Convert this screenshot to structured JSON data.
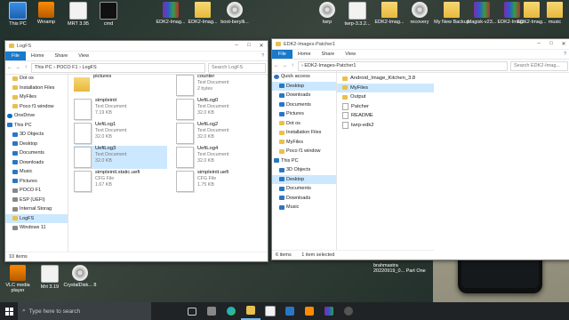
{
  "desktop_icons": {
    "this_pc": "This PC",
    "winamp": "Winamp",
    "mrt395": "MRT 3.95",
    "cmd": "cmd",
    "edk2_1": "EDK2-Imag...",
    "edk2_2": "EDK2-Imag...",
    "boot_beryllium": "boot-berylli...",
    "twrp": "twrp",
    "twrp_3_3": "twrp-3.3.2...",
    "edk2_3": "EDK2-Imag...",
    "recovery": "recovery",
    "my_new_backup": "My New Backup",
    "magisk": "Magisk-v23...",
    "edk2_4": "EDK2-Imag...",
    "edk2_5": "EDK2-Imag...",
    "music": "music",
    "vlc": "VLC media player",
    "mrt319": "Mrt 3.19",
    "crystaldisk": "CrystalDisk... 8",
    "brahmastra": "brahmastra 20220919_0... Part One"
  },
  "left_window": {
    "title": "LogFS",
    "ribbon": {
      "file": "File",
      "home": "Home",
      "share": "Share",
      "view": "View"
    },
    "path": "This PC  ›  POCO F1  ›  LogFS",
    "search_placeholder": "Search LogFS",
    "nav": [
      {
        "label": "Dot os",
        "icon": "folder"
      },
      {
        "label": "Installation Files",
        "icon": "folder"
      },
      {
        "label": "MyFiles",
        "icon": "folder"
      },
      {
        "label": "Poco f1 window",
        "icon": "folder"
      },
      {
        "label": "OneDrive",
        "icon": "cloud"
      },
      {
        "label": "This PC",
        "icon": "pc"
      },
      {
        "label": "3D Objects",
        "icon": "blue"
      },
      {
        "label": "Desktop",
        "icon": "blue"
      },
      {
        "label": "Documents",
        "icon": "blue"
      },
      {
        "label": "Downloads",
        "icon": "blue"
      },
      {
        "label": "Music",
        "icon": "music"
      },
      {
        "label": "Pictures",
        "icon": "blue"
      },
      {
        "label": "POCO F1",
        "icon": "drive"
      },
      {
        "label": "ESP (UEFI)",
        "icon": "drive"
      },
      {
        "label": "Internal Storag",
        "icon": "drive"
      },
      {
        "label": "LogFS",
        "icon": "folder"
      },
      {
        "label": "Windows 11",
        "icon": "drive"
      }
    ],
    "files": [
      {
        "name": "pictures",
        "type": "",
        "size": ""
      },
      {
        "name": "counter",
        "type": "Text Document",
        "size": "2 bytes"
      },
      {
        "name": "simpleinit",
        "type": "Text Document",
        "size": "7.19 KB"
      },
      {
        "name": "UefiLog0",
        "type": "Text Document",
        "size": "32.0 KB"
      },
      {
        "name": "UefiLog1",
        "type": "Text Document",
        "size": "32.0 KB"
      },
      {
        "name": "UefiLog2",
        "type": "Text Document",
        "size": "32.0 KB"
      },
      {
        "name": "UefiLog3",
        "type": "Text Document",
        "size": "32.0 KB"
      },
      {
        "name": "UefiLog4",
        "type": "Text Document",
        "size": "32.0 KB"
      },
      {
        "name": "simpleinit.static.uefi",
        "type": "CFG File",
        "size": "1.67 KB"
      },
      {
        "name": "simpleinit.uefi",
        "type": "CFG File",
        "size": "1.75 KB"
      }
    ],
    "status": "10 items"
  },
  "right_window": {
    "title": "EDK2-Images-Patcher1",
    "ribbon": {
      "file": "File",
      "home": "Home",
      "share": "Share",
      "view": "View"
    },
    "path": "›  EDK2-Images-Patcher1",
    "search_placeholder": "Search EDK2-Imag...",
    "nav": [
      {
        "label": "Quick access",
        "icon": "star"
      },
      {
        "label": "Desktop",
        "icon": "blue"
      },
      {
        "label": "Downloads",
        "icon": "blue"
      },
      {
        "label": "Documents",
        "icon": "blue"
      },
      {
        "label": "Pictures",
        "icon": "blue"
      },
      {
        "label": "Dot os",
        "icon": "folder"
      },
      {
        "label": "Installation Files",
        "icon": "folder"
      },
      {
        "label": "MyFiles",
        "icon": "folder"
      },
      {
        "label": "Poco f1 window",
        "icon": "folder"
      },
      {
        "label": "This PC",
        "icon": "pc"
      },
      {
        "label": "3D Objects",
        "icon": "blue"
      },
      {
        "label": "Desktop",
        "icon": "blue"
      },
      {
        "label": "Documents",
        "icon": "blue"
      },
      {
        "label": "Downloads",
        "icon": "blue"
      },
      {
        "label": "Music",
        "icon": "music"
      }
    ],
    "files": [
      {
        "name": "Android_Image_Kitchen_3.8",
        "kind": "folder"
      },
      {
        "name": "MyFiles",
        "kind": "folder"
      },
      {
        "name": "Output",
        "kind": "folder"
      },
      {
        "name": "Patcher",
        "kind": "file"
      },
      {
        "name": "README",
        "kind": "file"
      },
      {
        "name": "twrp-edk2",
        "kind": "file"
      }
    ],
    "status_items": "6 items",
    "status_selected": "1 item selected"
  },
  "taskbar": {
    "search_placeholder": "Type here to search"
  }
}
